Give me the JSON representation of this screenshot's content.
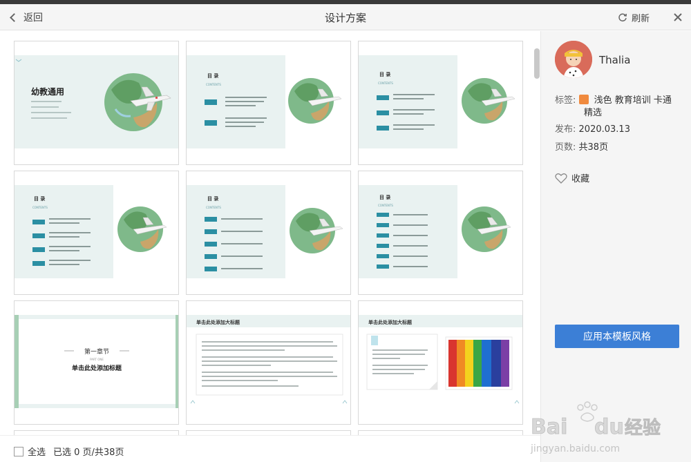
{
  "header": {
    "back_label": "返回",
    "title": "设计方案",
    "refresh_label": "刷新"
  },
  "cards": [
    {
      "kind": "cover",
      "title": "幼教通用"
    },
    {
      "kind": "contents2",
      "heading": "目 录",
      "sub": "CONTENTS",
      "items": [
        "01",
        "02"
      ]
    },
    {
      "kind": "contents3",
      "heading": "目 录",
      "sub": "CONTENTS",
      "items": [
        "01",
        "02",
        "03"
      ]
    },
    {
      "kind": "contents4",
      "heading": "目 录",
      "sub": "CONTENTS",
      "items": [
        "01",
        "02",
        "03",
        "04"
      ]
    },
    {
      "kind": "contents5",
      "heading": "目 录",
      "sub": "CONTENTS",
      "items": [
        "01",
        "02",
        "03",
        "04",
        "05"
      ]
    },
    {
      "kind": "contents6",
      "heading": "目 录",
      "sub": "CONTENTS",
      "items": [
        "01",
        "02",
        "03",
        "04",
        "05",
        "06"
      ]
    },
    {
      "kind": "chapter",
      "chapter": "第一章节",
      "part": "PART ONE",
      "subtitle": "单击此处添加标题"
    },
    {
      "kind": "text",
      "title": "单击此处添加大标题"
    },
    {
      "kind": "textimage",
      "title": "单击此处添加大标题"
    }
  ],
  "footer": {
    "select_all": "全选",
    "selected_count": "已选 0 页/共38页"
  },
  "sidebar": {
    "username": "Thalia",
    "tags_label": "标签:",
    "tags_line1": "浅色 教育培训 卡通",
    "tags_line2": "精选",
    "date_label": "发布:",
    "date_value": "2020.03.13",
    "pages_label": "页数:",
    "pages_value": "共38页",
    "favorite_label": "收藏",
    "apply_label": "应用本模板风格"
  },
  "colors": {
    "accent": "#3c7fd6",
    "slide_teal": "#2b8fa3",
    "slide_bg": "#e9f2f1"
  },
  "watermark": {
    "text1": "Bai",
    "text2": "du",
    "text3": "经验",
    "url": "jingyan.baidu.com"
  }
}
